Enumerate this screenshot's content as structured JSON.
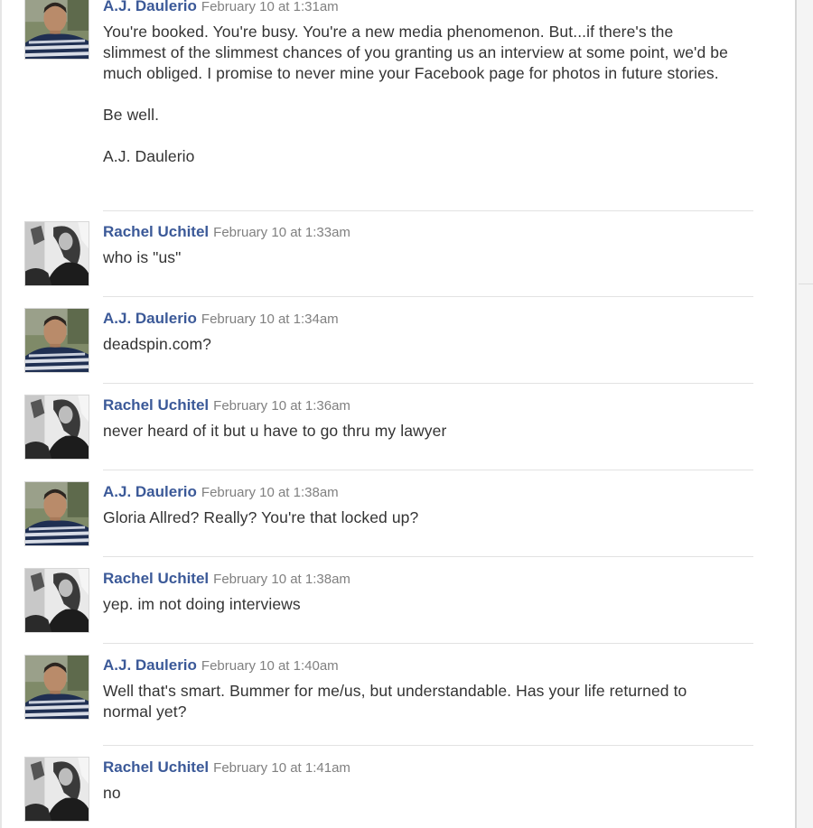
{
  "colors": {
    "author_link": "#3b5998",
    "timestamp": "#808080",
    "body_text": "#333333",
    "separator": "#e2e2e2"
  },
  "messages": [
    {
      "author": "A.J. Daulerio",
      "timestamp": "February 10 at 1:31am",
      "avatar": "aj-daulerio-avatar",
      "paragraphs": [
        "You're booked. You're busy. You're a new media phenomenon. But...if there's the slimmest of the slimmest chances of you granting us an interview at some point, we'd be much obliged. I promise to never mine your Facebook page for photos in future stories.",
        "Be well.",
        "A.J. Daulerio"
      ]
    },
    {
      "author": "Rachel Uchitel",
      "timestamp": "February 10 at 1:33am",
      "avatar": "rachel-uchitel-avatar",
      "paragraphs": [
        "who is \"us\""
      ]
    },
    {
      "author": "A.J. Daulerio",
      "timestamp": "February 10 at 1:34am",
      "avatar": "aj-daulerio-avatar",
      "paragraphs": [
        "deadspin.com?"
      ]
    },
    {
      "author": "Rachel Uchitel",
      "timestamp": "February 10 at 1:36am",
      "avatar": "rachel-uchitel-avatar",
      "paragraphs": [
        "never heard of it but u have to go thru my lawyer"
      ]
    },
    {
      "author": "A.J. Daulerio",
      "timestamp": "February 10 at 1:38am",
      "avatar": "aj-daulerio-avatar",
      "paragraphs": [
        "Gloria Allred? Really? You're that locked up?"
      ]
    },
    {
      "author": "Rachel Uchitel",
      "timestamp": "February 10 at 1:38am",
      "avatar": "rachel-uchitel-avatar",
      "paragraphs": [
        "yep. im not doing interviews"
      ]
    },
    {
      "author": "A.J. Daulerio",
      "timestamp": "February 10 at 1:40am",
      "avatar": "aj-daulerio-avatar",
      "paragraphs": [
        "Well that's smart. Bummer for me/us, but understandable. Has your life returned to normal yet?"
      ]
    },
    {
      "author": "Rachel Uchitel",
      "timestamp": "February 10 at 1:41am",
      "avatar": "rachel-uchitel-avatar",
      "paragraphs": [
        "no"
      ]
    }
  ]
}
